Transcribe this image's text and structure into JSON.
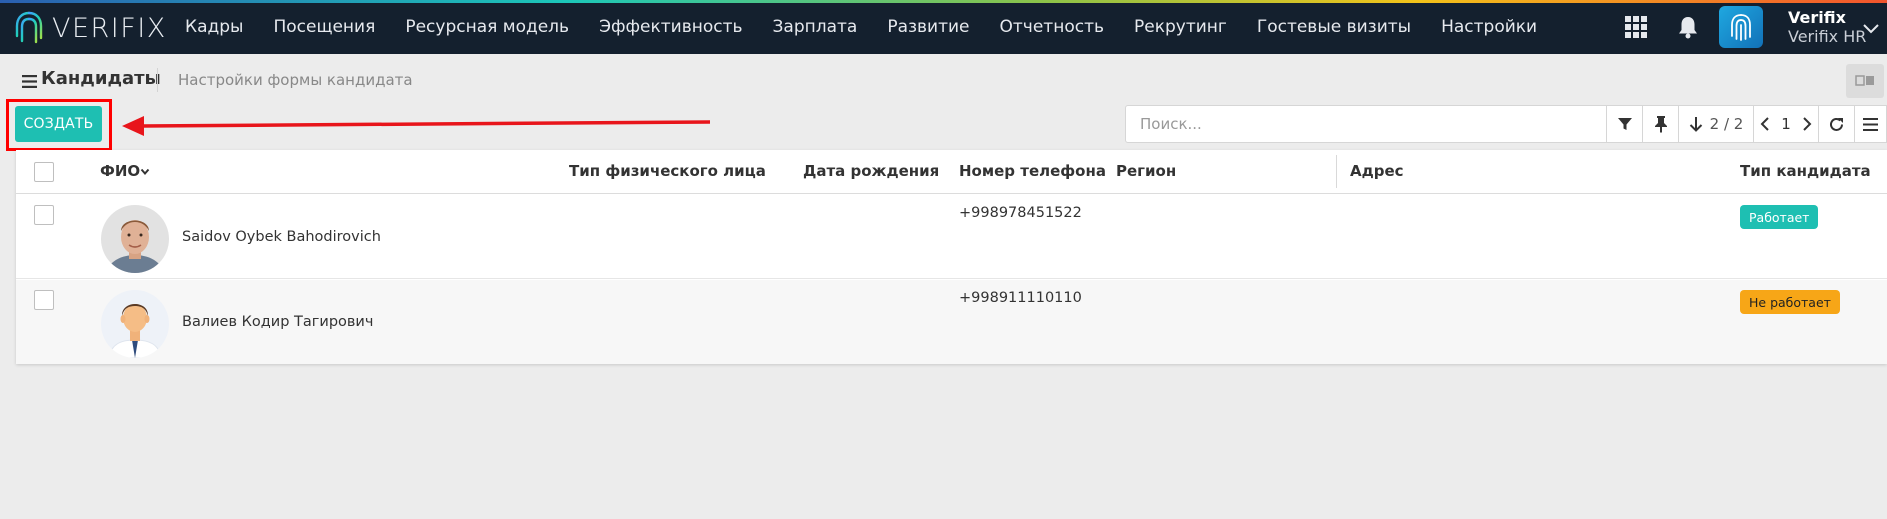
{
  "app": {
    "brand": "VERIFIX"
  },
  "nav": {
    "menu": [
      "Кадры",
      "Посещения",
      "Ресурсная модель",
      "Эффективность",
      "Зарплата",
      "Развитие",
      "Отчетность",
      "Рекрутинг",
      "Гостевые визиты",
      "Настройки"
    ],
    "user": {
      "name": "Verifix",
      "company": "Verifix HR"
    }
  },
  "breadcrumb": {
    "title": "Кандидаты",
    "subtitle": "Настройки формы кандидата"
  },
  "toolbar": {
    "create_label": "СОЗДАТЬ",
    "search_placeholder": "Поиск...",
    "sort_count": "2 / 2",
    "page": "1"
  },
  "table": {
    "columns": [
      "ФИО",
      "Тип физического лица",
      "Дата рождения",
      "Номер телефона",
      "Регион",
      "Адрес",
      "Тип кандидата"
    ],
    "rows": [
      {
        "name": "Saidov Oybek Bahodirovich",
        "person_type": "",
        "birth_date": "",
        "phone": "+998978451522",
        "region": "",
        "address": "",
        "status": "Работает",
        "status_color": "#1ebfb2"
      },
      {
        "name": "Валиев Кодир Тагирович",
        "person_type": "",
        "birth_date": "",
        "phone": "+998911110110",
        "region": "",
        "address": "",
        "status": "Не работает",
        "status_color": "#f7a617"
      }
    ]
  },
  "colors": {
    "nav_bg": "#14202e",
    "accent": "#1ebfb2",
    "warning": "#f7a617",
    "annotation": "#ff0000"
  }
}
